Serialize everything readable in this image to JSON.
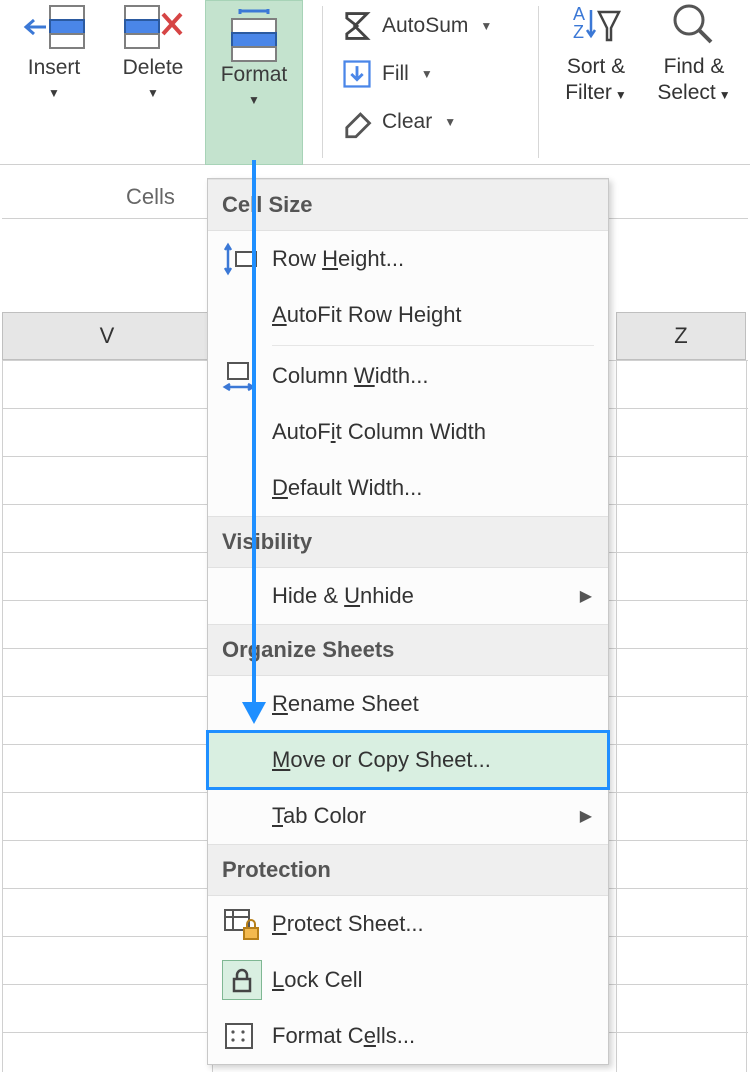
{
  "ribbon": {
    "insert_label": "Insert",
    "delete_label": "Delete",
    "format_label": "Format",
    "autosum_label": "AutoSum",
    "fill_label": "Fill",
    "clear_label": "Clear",
    "sort_filter_line1": "Sort &",
    "sort_filter_line2": "Filter",
    "find_select_line1": "Find &",
    "find_select_line2": "Select",
    "cells_group": "Cells"
  },
  "columns": {
    "v": "V",
    "z": "Z"
  },
  "menu": {
    "sections": {
      "cell_size": "Cell Size",
      "visibility": "Visibility",
      "organize": "Organize Sheets",
      "protection": "Protection"
    },
    "row_height_pre": "Row ",
    "row_height_u": "H",
    "row_height_post": "eight...",
    "autofit_row_pre": "",
    "autofit_row_u": "A",
    "autofit_row_post": "utoFit Row Height",
    "col_width_pre": "Column ",
    "col_width_u": "W",
    "col_width_post": "idth...",
    "autofit_col_pre": "AutoF",
    "autofit_col_u": "i",
    "autofit_col_post": "t Column Width",
    "default_width_pre": "",
    "default_width_u": "D",
    "default_width_post": "efault Width...",
    "hide_unhide_pre": "Hide & ",
    "hide_unhide_u": "U",
    "hide_unhide_post": "nhide",
    "rename_pre": "",
    "rename_u": "R",
    "rename_post": "ename Sheet",
    "move_copy_pre": "",
    "move_copy_u": "M",
    "move_copy_post": "ove or Copy Sheet...",
    "tab_color_pre": "",
    "tab_color_u": "T",
    "tab_color_post": "ab Color",
    "protect_pre": "",
    "protect_u": "P",
    "protect_post": "rotect Sheet...",
    "lock_cell_pre": "",
    "lock_cell_u": "L",
    "lock_cell_post": "ock Cell",
    "format_cells_pre": "Format C",
    "format_cells_u": "e",
    "format_cells_post": "lls..."
  }
}
